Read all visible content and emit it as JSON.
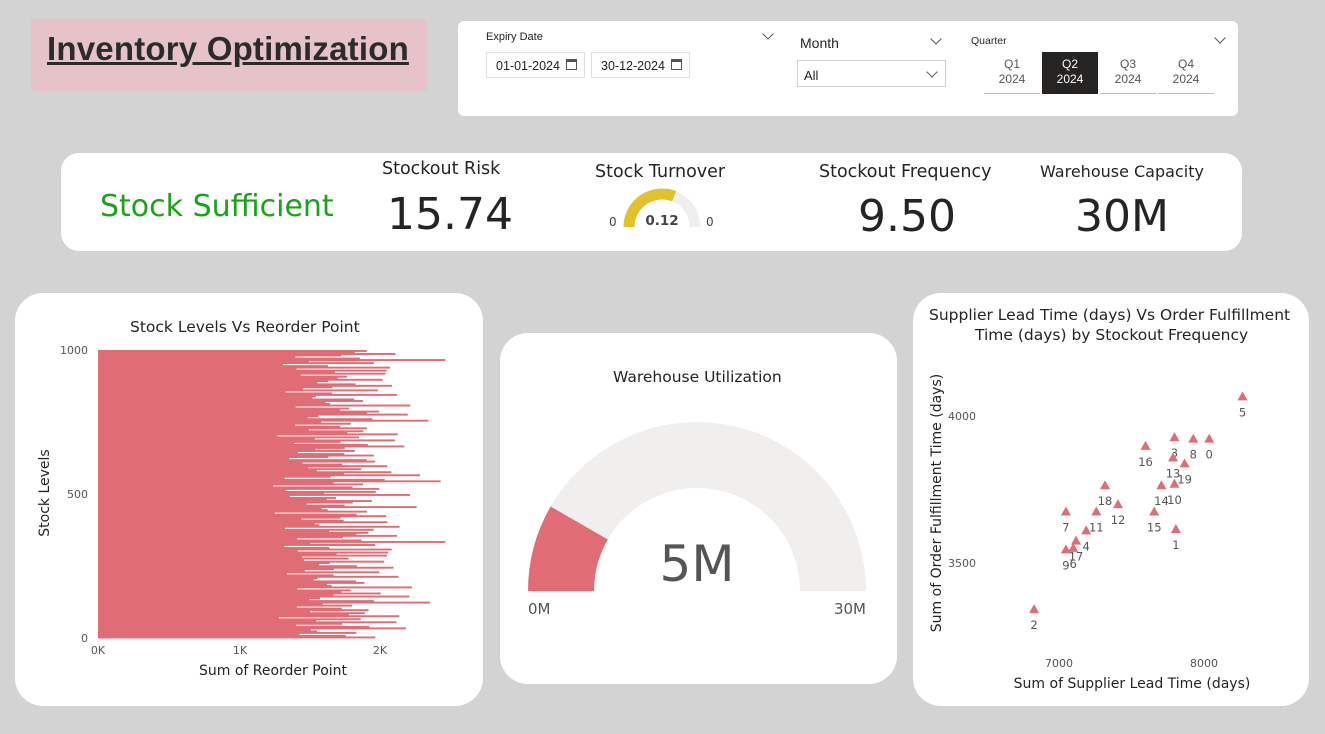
{
  "header": {
    "title": "Inventory Optimization"
  },
  "filters": {
    "expiry": {
      "label": "Expiry Date",
      "start": "01-01-2024",
      "end": "30-12-2024"
    },
    "month": {
      "label": "Month",
      "selected": "All"
    },
    "quarter": {
      "label": "Quarter",
      "tiles": [
        {
          "q": "Q1",
          "year": "2024",
          "active": false
        },
        {
          "q": "Q2",
          "year": "2024",
          "active": true
        },
        {
          "q": "Q3",
          "year": "2024",
          "active": false
        },
        {
          "q": "Q4",
          "year": "2024",
          "active": false
        }
      ]
    }
  },
  "kpis": {
    "status": "Stock Sufficient",
    "stockout_risk": {
      "title": "Stockout Risk",
      "value": "15.74"
    },
    "stock_turnover": {
      "title": "Stock Turnover",
      "value": "0.12",
      "min": "0",
      "max": "0",
      "fill": 0.62
    },
    "stockout_frequency": {
      "title": "Stockout Frequency",
      "value": "9.50"
    },
    "warehouse_capacity": {
      "title": "Warehouse Capacity",
      "value": "30M"
    }
  },
  "colors": {
    "accent": "#e06c75",
    "gauge_yellow": "#e3c12e",
    "status_green": "#1aa31a",
    "track": "#f0efee"
  },
  "stock_chart": {
    "title": "Stock Levels Vs Reorder Point",
    "xlabel": "Sum of Reorder Point",
    "ylabel": "Stock Levels",
    "xticks": [
      "0K",
      "1K",
      "2K"
    ],
    "yticks": [
      "1000",
      "500",
      "0"
    ]
  },
  "warehouse_gauge": {
    "title": "Warehouse Utilization",
    "value_label": "5M",
    "min_label": "0M",
    "max_label": "30M",
    "value": 5,
    "max": 30
  },
  "chart_data": [
    {
      "type": "bar",
      "orientation": "horizontal",
      "title": "Stock Levels Vs Reorder Point",
      "xlabel": "Sum of Reorder Point",
      "ylabel": "Stock Levels",
      "xlim": [
        0,
        2500
      ],
      "ylim": [
        0,
        1000
      ],
      "x_ticks": [
        "0K",
        "1K",
        "2K"
      ],
      "y_ticks": [
        0,
        500,
        1000
      ],
      "note_values": [
        2040,
        1800,
        2190,
        1650,
        1420,
        1980,
        2480,
        1560,
        1870,
        1320,
        1740,
        2030,
        1460,
        1950,
        1680,
        2140,
        1380,
        1810,
        1590,
        2010,
        1720,
        1490,
        1860,
        2220,
        1640,
        1530,
        1910,
        1350,
        1780,
        2090,
        1610,
        1430,
        1830,
        1990,
        1570,
        1700,
        2120,
        1400,
        1880,
        1660
      ]
    },
    {
      "type": "scatter",
      "title": "Supplier Lead Time (days) Vs Order Fulfillment Time (days) by Stockout Frequency",
      "xlabel": "Sum of Supplier Lead Time (days)",
      "ylabel": "Sum of Order Fulfillment Time (days)",
      "xlim": [
        6550,
        8450
      ],
      "ylim": [
        3260,
        4200
      ],
      "x_ticks": [
        7000,
        8000
      ],
      "y_ticks": [
        3500,
        4000
      ],
      "points": [
        {
          "label": "5",
          "x": 8260,
          "y": 4120
        },
        {
          "label": "3",
          "x": 7790,
          "y": 3980
        },
        {
          "label": "8",
          "x": 7920,
          "y": 3975
        },
        {
          "label": "0",
          "x": 8030,
          "y": 3975
        },
        {
          "label": "16",
          "x": 7590,
          "y": 3950
        },
        {
          "label": "13",
          "x": 7780,
          "y": 3910
        },
        {
          "label": "19",
          "x": 7860,
          "y": 3890
        },
        {
          "label": "14",
          "x": 7700,
          "y": 3815
        },
        {
          "label": "10",
          "x": 7790,
          "y": 3820
        },
        {
          "label": "18",
          "x": 7310,
          "y": 3815
        },
        {
          "label": "12",
          "x": 7400,
          "y": 3750
        },
        {
          "label": "11",
          "x": 7250,
          "y": 3725
        },
        {
          "label": "7",
          "x": 7040,
          "y": 3725
        },
        {
          "label": "15",
          "x": 7650,
          "y": 3725
        },
        {
          "label": "1",
          "x": 7800,
          "y": 3665
        },
        {
          "label": "4",
          "x": 7180,
          "y": 3660
        },
        {
          "label": "9",
          "x": 7040,
          "y": 3595
        },
        {
          "label": "6",
          "x": 7090,
          "y": 3600
        },
        {
          "label": "17",
          "x": 7110,
          "y": 3625
        },
        {
          "label": "2",
          "x": 6820,
          "y": 3390
        }
      ]
    }
  ],
  "scatter_chart": {
    "title_line1": "Supplier Lead Time (days) Vs Order Fulfillment",
    "title_line2": "Time (days) by Stockout Frequency",
    "xlabel": "Sum of Supplier Lead Time (days)",
    "ylabel": "Sum of Order Fulfillment Time (days)",
    "xticks": [
      "7000",
      "8000"
    ],
    "yticks": [
      "4000",
      "3500"
    ]
  }
}
